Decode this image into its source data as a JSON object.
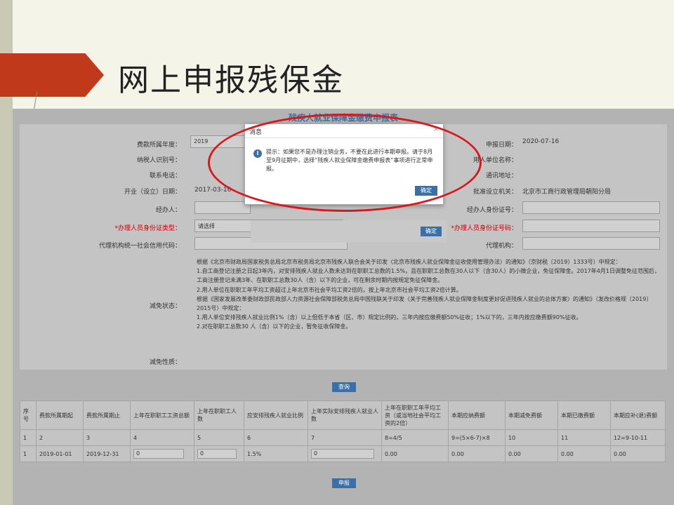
{
  "slide": {
    "title": "网上申报残保金"
  },
  "form": {
    "title": "残疾人就业保障金缴费申报表",
    "fields": {
      "fee_year_label": "费款所属年度：",
      "fee_year_value": "2019",
      "taxpayer_id_label": "纳税人识别号：",
      "contact_phone_label": "联系电话：",
      "open_date_label": "开业（设立）日期：",
      "open_date_value": "2017-03-16",
      "handler_label": "经办人：",
      "id_type_label": "*办理人员身份证类型：",
      "id_type_value": "请选择",
      "agent_credit_label": "代理机构统一社会信用代码：",
      "report_date_label": "申报日期：",
      "report_date_value": "2020-07-16",
      "employer_name_label": "用人单位名称：",
      "address_label": "通讯地址：",
      "approval_org_label": "批准设立机关：",
      "approval_org_value": "北京市工商行政管理局朝阳分局",
      "handler_id_label": "经办人身份证号：",
      "processor_id_label": "*办理人员身份证号码：",
      "agent_label": "代理机构：",
      "relief_status_label": "减免状态：",
      "relief_nature_label": "减免性质："
    },
    "notice": [
      "根据《北京市财政局国家税务总局北京市税务局北京市残疾人联合会关于印发〈北京市残疾人就业保障金征收使用管理办法〉的通知》（京财税〔2019〕1333号）中规定：",
      "1.自工商登记注册之日起3年内，对安排残疾人就业人数未达到在职职工总数的1.5%，且在职职工总数在30人以下（含30人）的小微企业，免征保障金。2017年4月1日调整免征范围后，工商注册登记未满3年、在职职工总数30人（含）以下的企业，可在剩余时期内按规定免征保障金。",
      "2.用人单位在职职工年平均工资超过上年北京市社会平均工资2倍的，按上年北京市社会平均工资2倍计算。",
      "根据《国家发展改革委财政部民政部人力资源社会保障部税务总局中国残联关于印发〈关于完善残疾人就业保障金制度更好促进残疾人就业的总体方案〉的通知》（发改价格规〔2019〕2015号）中规定：",
      "1.用人单位安排残疾人就业比例1%（含）以上但低于本省（区、市）规定比例的，三年内按应缴费额50%征收；1%以下的，三年内按应缴费额90%征收。",
      "2.对在职职工总数30 人（含）以下的企业，暂免征收保障金。"
    ],
    "query_button": "查询",
    "submit_button": "申报",
    "behind_ok_button": "确定"
  },
  "table": {
    "headers": [
      "序号",
      "费款所属期起",
      "费款所属期止",
      "上年在职职工工资总额",
      "上年在职职工人数",
      "应安排残疾人就业比例",
      "上年实际安排残疾人就业人数",
      "上年在职职工年平均工资（或当地社会平均工资的2倍）",
      "本期应纳费额",
      "本期减免费额",
      "本期已缴费额",
      "本期应补(退)费额"
    ],
    "index_row": [
      "1",
      "2",
      "3",
      "4",
      "5",
      "6",
      "7",
      "8=4/5",
      "9=(5×6-7)×8",
      "10",
      "11",
      "12=9-10-11"
    ],
    "data_row": [
      "1",
      "2019-01-01",
      "2019-12-31",
      "0",
      "0",
      "1.5%",
      "0",
      "0.00",
      "0.00",
      "0.00",
      "0.00",
      "0.00"
    ]
  },
  "dialog": {
    "title": "消息",
    "message": "提示：如果您不是办理注销业务，不要在此进行本期申报。请于8月至9月征期中，选择“残疾人就业保障金缴费申报表”事项进行正常申报。",
    "ok": "确定",
    "close": "×"
  },
  "colors": {
    "accent_red": "#c0391b",
    "button_blue": "#3a6fa8",
    "highlight_circle": "#d8181c"
  }
}
